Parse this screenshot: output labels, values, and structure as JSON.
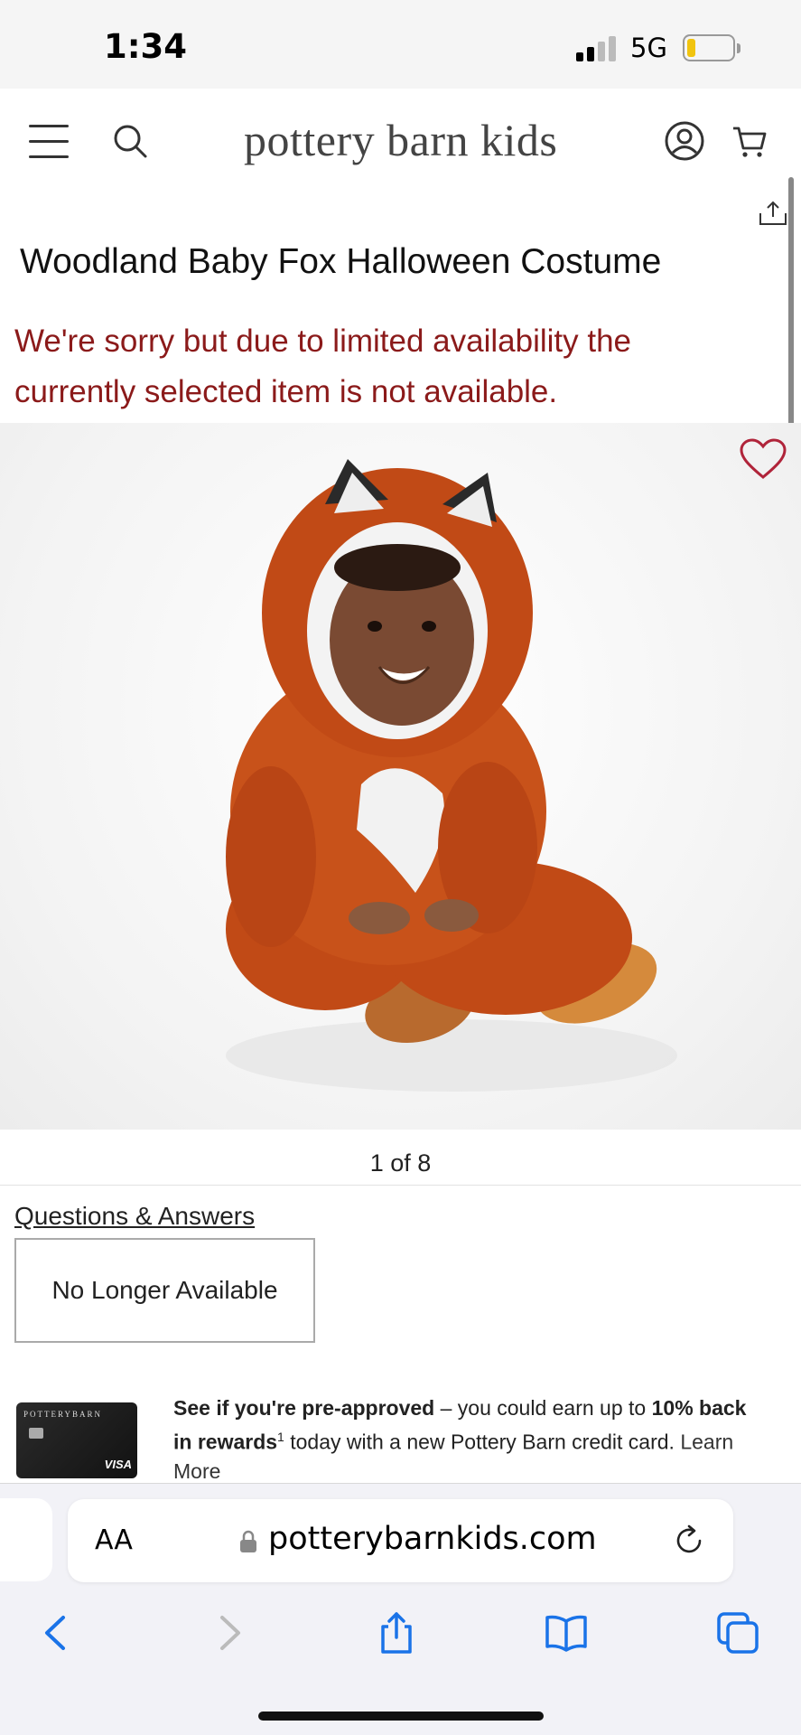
{
  "status_bar": {
    "time": "1:34",
    "network": "5G"
  },
  "header": {
    "logo": "pottery barn kids"
  },
  "product": {
    "title": "Woodland Baby Fox Halloween Costume",
    "unavailable_message": "We're sorry but due to limited availability the currently selected item is not available.",
    "image_counter": "1 of 8"
  },
  "links": {
    "questions_answers": "Questions & Answers"
  },
  "buttons": {
    "no_longer_available": "No Longer Available"
  },
  "promo": {
    "card_brand": "POTTERYBARN",
    "card_network": "VISA",
    "bold_1": "See if you're pre-approved",
    "text_1": " – you could earn up to ",
    "bold_2": "10% back in rewards",
    "sup": "1",
    "text_2": " today with a new Pottery Barn credit card. ",
    "learn_more": "Learn More"
  },
  "browser": {
    "aa_label": "AA",
    "url": "potterybarnkids.com"
  },
  "colors": {
    "alert": "#8b1a1a",
    "accent_heart": "#b0243a",
    "safari_blue": "#1a73e8"
  }
}
